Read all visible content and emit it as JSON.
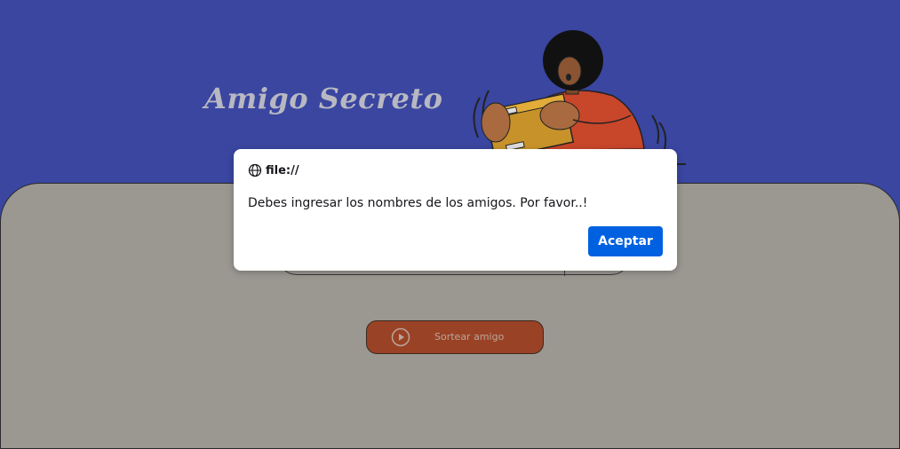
{
  "header": {
    "title": "Amigo Secreto",
    "illustration": "person-holding-gift-box"
  },
  "main": {
    "draw_button_label": "Sortear amigo",
    "draw_button_icon": "play-circle-icon"
  },
  "dialog": {
    "origin": "file://",
    "origin_icon": "globe-icon",
    "message": "Debes ingresar los nombres de los amigos. Por favor..!",
    "ok_label": "Aceptar"
  },
  "colors": {
    "header_bg": "#3a46a0",
    "main_bg": "#9b9791",
    "draw_button_bg": "#9a4225",
    "dialog_button_bg": "#0061e0"
  }
}
